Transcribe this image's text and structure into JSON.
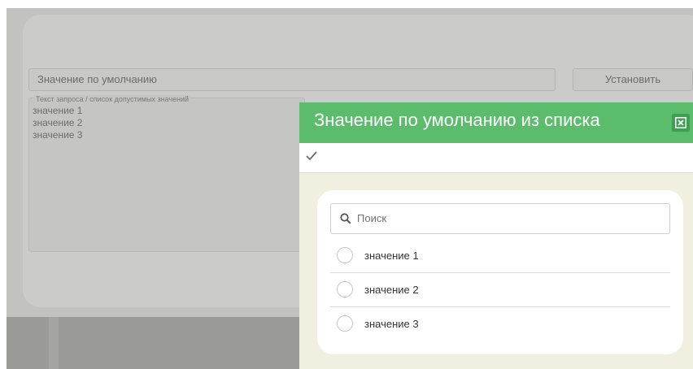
{
  "background_form": {
    "default_value_placeholder": "Значение по умолчанию",
    "set_button_label": "Установить",
    "query_legend": "Текст запроса / список допустимых значений",
    "query_lines": [
      "значение 1",
      "значение 2",
      "значение 3"
    ]
  },
  "modal": {
    "title": "Значение по умолчанию из списка",
    "toolbar_icon": "check-icon",
    "close_icon": "close-icon",
    "search_placeholder": "Поиск",
    "options": [
      {
        "label": "значение 1",
        "selected": false
      },
      {
        "label": "значение 2",
        "selected": false
      },
      {
        "label": "значение 3",
        "selected": false
      }
    ]
  },
  "colors": {
    "header_green": "#5bbd6c",
    "close_button": "#3f9e52",
    "overlay_gray": "#c2c2c0",
    "modal_body": "#f0efe0"
  }
}
